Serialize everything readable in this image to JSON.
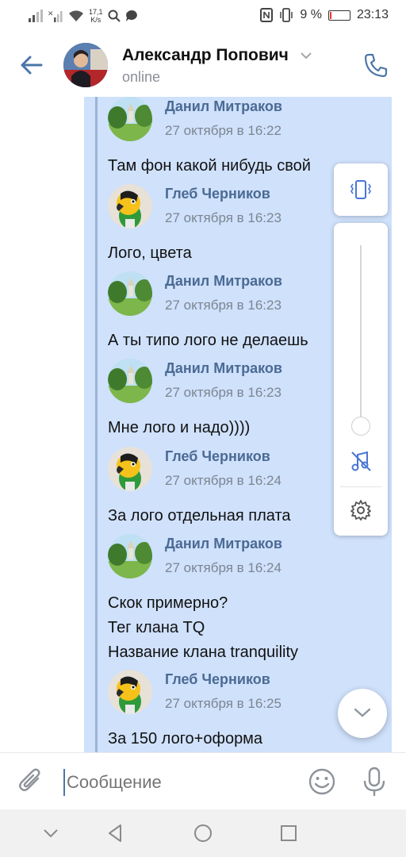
{
  "statusbar": {
    "net_speed_value": "17,1",
    "net_speed_unit": "K/s",
    "battery_percent": "9 %",
    "battery_level": 0.09,
    "time": "23:13"
  },
  "header": {
    "contact_name": "Александр Попович",
    "status": "online"
  },
  "messages": [
    {
      "author": "Данил Митраков",
      "time": "27 октября в 16:22",
      "text": "Там фон какой нибудь свой",
      "avatar": "park"
    },
    {
      "author": "Глеб Черников",
      "time": "27 октября в 16:23",
      "text": "Лого, цвета",
      "avatar": "parrot"
    },
    {
      "author": "Данил Митраков",
      "time": "27 октября в 16:23",
      "text": "А ты типо лого не делаешь",
      "avatar": "park"
    },
    {
      "author": "Данил Митраков",
      "time": "27 октября в 16:23",
      "text": "Мне лого и надо))))",
      "avatar": "park"
    },
    {
      "author": "Глеб Черников",
      "time": "27 октября в 16:24",
      "text": "За лого отдельная плата",
      "avatar": "parrot"
    },
    {
      "author": "Данил Митраков",
      "time": "27 октября в 16:24",
      "text_lines": [
        "Скок примерно?",
        "Тег клана TQ",
        "Название клана tranquility"
      ],
      "avatar": "park"
    },
    {
      "author": "Глеб Черников",
      "time": "27 октября в 16:25",
      "text": "За 150 лого+оформа",
      "avatar": "parrot"
    }
  ],
  "volume_panel": {
    "level": 0.0,
    "icons": [
      "vibrate-icon",
      "music-mute-icon",
      "gear-icon"
    ]
  },
  "composer": {
    "placeholder": "Сообщение"
  },
  "colors": {
    "accent": "#4a76a8",
    "author": "#4b6a94",
    "forward_bg": "#cfe1fb"
  }
}
